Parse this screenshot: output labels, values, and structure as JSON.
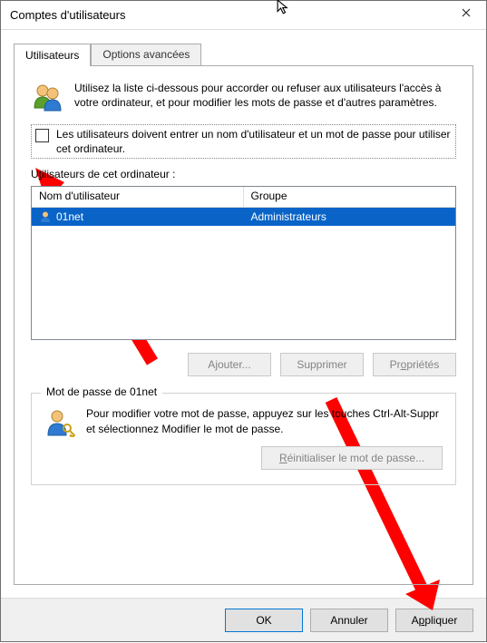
{
  "window": {
    "title": "Comptes d'utilisateurs"
  },
  "tabs": {
    "users": "Utilisateurs",
    "advanced": "Options avancées"
  },
  "intro": "Utilisez la liste ci-dessous pour accorder ou refuser aux utilisateurs l'accès à votre ordinateur, et pour modifier les mots de passe et d'autres paramètres.",
  "checkbox": {
    "text": "Les utilisateurs doivent entrer un nom d'utilisateur et un mot de passe pour utiliser cet ordinateur.",
    "checked": false
  },
  "list": {
    "caption_html": "U<u>t</u>ilisateurs de cet ordinateur :",
    "col_user": "Nom d'utilisateur",
    "col_group": "Groupe",
    "rows": [
      {
        "user": "01net",
        "group": "Administrateurs",
        "selected": true,
        "icon": "user-admin"
      }
    ]
  },
  "row_buttons": {
    "add_html": "A<u>j</u>outer...",
    "remove": "Supprimer",
    "props_html": "Pr<u>o</u>priétés"
  },
  "password_group": {
    "title": "Mot de passe de 01net",
    "text": "Pour modifier votre mot de passe, appuyez sur les touches Ctrl-Alt-Suppr et sélectionnez Modifier le mot de passe.",
    "reset_html": "<u>R</u>éinitialiser le mot de passe..."
  },
  "dialog_buttons": {
    "ok": "OK",
    "cancel": "Annuler",
    "apply_html": "A<u>p</u>pliquer"
  }
}
